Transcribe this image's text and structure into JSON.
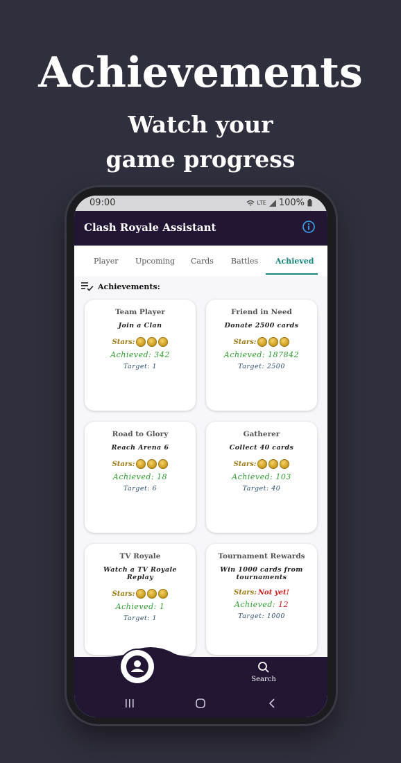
{
  "hero": {
    "title": "Achievements",
    "subtitle_line1": "Watch your",
    "subtitle_line2": "game progress"
  },
  "status_bar": {
    "time": "09:00",
    "network": "LTE",
    "battery": "100%"
  },
  "app_bar": {
    "title": "Clash Royale Assistant",
    "info_icon": "info-icon"
  },
  "tabs": [
    {
      "label": "Player",
      "active": false
    },
    {
      "label": "Upcoming",
      "active": false
    },
    {
      "label": "Cards",
      "active": false
    },
    {
      "label": "Battles",
      "active": false
    },
    {
      "label": "Achieved",
      "active": true
    }
  ],
  "section": {
    "label": "Achievements:",
    "icon": "checklist-icon"
  },
  "labels": {
    "stars": "Stars:",
    "achieved": "Achieved:",
    "target": "Target:"
  },
  "achievements": [
    {
      "name": "Team Player",
      "desc": "Join a Clan",
      "stars": "3 medals",
      "achieved": "342",
      "target": "1"
    },
    {
      "name": "Friend in Need",
      "desc": "Donate 2500 cards",
      "stars": "3 medals",
      "achieved": "187842",
      "target": "2500"
    },
    {
      "name": "Road to Glory",
      "desc": "Reach Arena 6",
      "stars": "3 medals",
      "achieved": "18",
      "target": "6"
    },
    {
      "name": "Gatherer",
      "desc": "Collect 40 cards",
      "stars": "3 medals",
      "achieved": "103",
      "target": "40"
    },
    {
      "name": "TV Royale",
      "desc": "Watch a TV Royale Replay",
      "stars": "3 medals",
      "achieved": "1",
      "target": "1"
    },
    {
      "name": "Tournament Rewards",
      "desc": "Win 1000 cards from tournaments",
      "stars": "Not yet!",
      "achieved": "12",
      "target": "1000"
    }
  ],
  "bottom_nav": {
    "profile_icon": "person-icon",
    "search_label": "Search",
    "search_icon": "search-icon"
  },
  "system_nav": [
    "recents-icon",
    "home-icon",
    "back-icon"
  ],
  "colors": {
    "background": "#302f3d",
    "app_bar": "#221634",
    "accent": "#16857c",
    "achieved_green": "#2e9e2e",
    "not_yet_red": "#d02020"
  }
}
